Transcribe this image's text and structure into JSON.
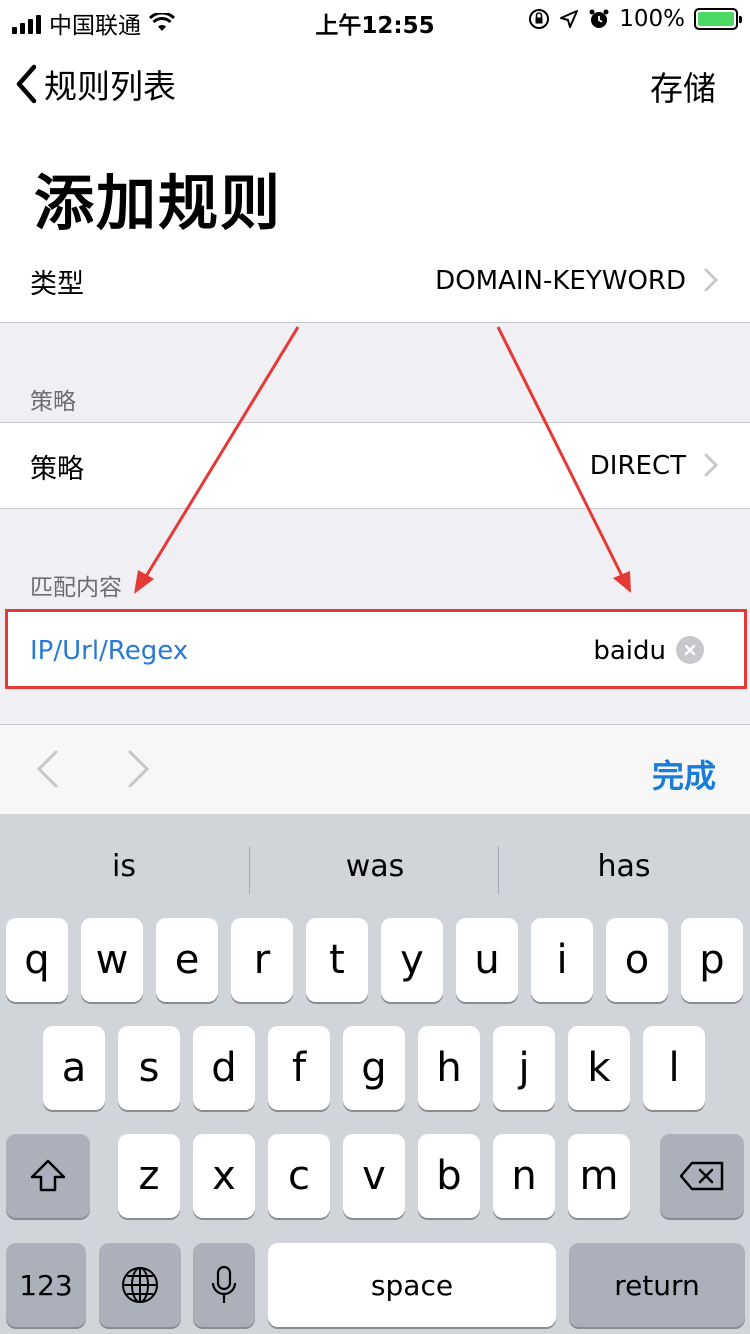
{
  "status_bar": {
    "carrier": "中国联通",
    "time": "上午12:55",
    "battery": "100%"
  },
  "nav": {
    "back_label": "规则列表",
    "save_label": "存储"
  },
  "title": "添加规则",
  "type_row": {
    "label": "类型",
    "value": "DOMAIN-KEYWORD"
  },
  "policy_section": {
    "header": "策略",
    "row_label": "策略",
    "row_value": "DIRECT"
  },
  "match_section": {
    "header": "匹配内容",
    "field_label": "IP/Url/Regex",
    "field_value": "baidu"
  },
  "accessory": {
    "done_label": "完成"
  },
  "keyboard": {
    "suggestions": [
      "is",
      "was",
      "has"
    ],
    "row1": [
      "q",
      "w",
      "e",
      "r",
      "t",
      "y",
      "u",
      "i",
      "o",
      "p"
    ],
    "row2": [
      "a",
      "s",
      "d",
      "f",
      "g",
      "h",
      "j",
      "k",
      "l"
    ],
    "row3": [
      "z",
      "x",
      "c",
      "v",
      "b",
      "n",
      "m"
    ],
    "numbers_label": "123",
    "space_label": "space",
    "return_label": "return"
  },
  "colors": {
    "accent": "#1a7cd8",
    "annotation": "#e53935",
    "battery": "#4cd964"
  }
}
